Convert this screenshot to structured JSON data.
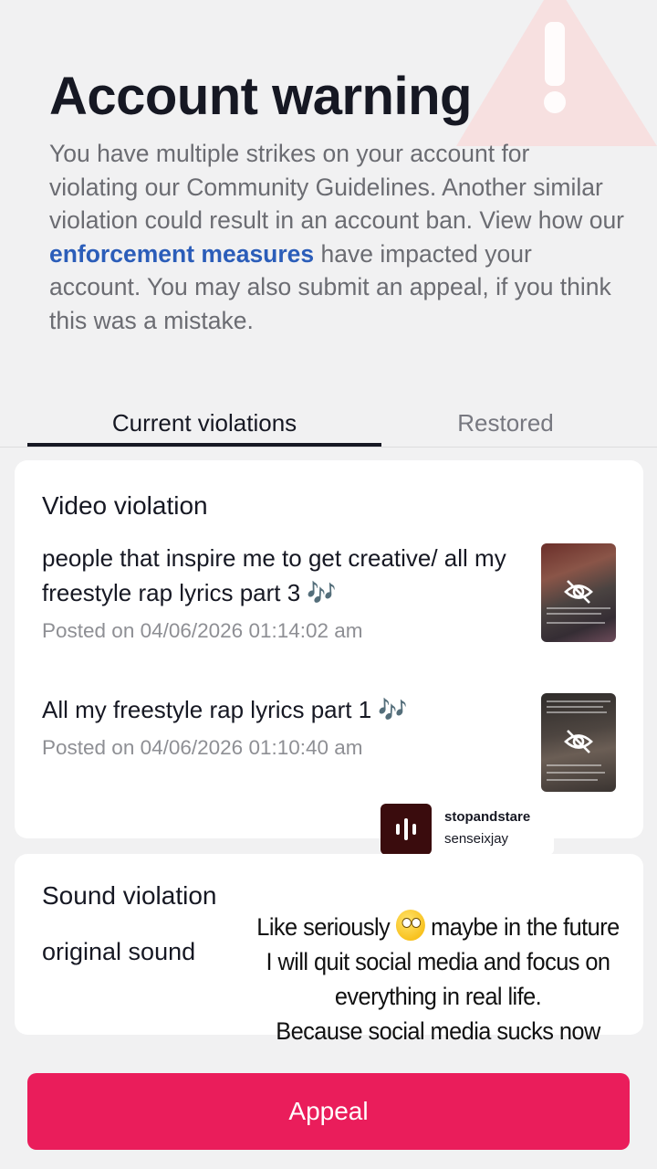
{
  "page": {
    "title": "Account warning",
    "description_before": "You have multiple strikes on your account for violating our Community Guidelines. Another similar violation could result in an account ban. View how our ",
    "description_link": "enforcement measures",
    "description_after": " have impacted your account. You may also submit an appeal, if you think this was a mistake."
  },
  "tabs": [
    {
      "label": "Current violations",
      "active": true
    },
    {
      "label": "Restored",
      "active": false
    }
  ],
  "video_card": {
    "title": "Video violation",
    "items": [
      {
        "title": "people that inspire me to get creative/ all my freestyle rap lyrics part 3 🎶",
        "posted": "Posted on 04/06/2026 01:14:02 am",
        "thumb_icon": "eye-off-icon"
      },
      {
        "title": "All my freestyle rap lyrics part 1 🎶",
        "posted": "Posted on 04/06/2026 01:10:40 am",
        "thumb_icon": "eye-off-icon"
      }
    ]
  },
  "sound_card": {
    "title": "Sound violation",
    "item": "original sound"
  },
  "sticker": {
    "name": "stopandstare",
    "username": "senseixjay"
  },
  "overlay_text": {
    "line1_before": "Like seriously",
    "line1_after": "maybe in the future",
    "line2": "I will quit social media and focus on",
    "line3": "everything in real life.",
    "line4": "Because social media sucks now"
  },
  "appeal_button": {
    "label": "Appeal"
  },
  "colors": {
    "accent": "#ea1d5b",
    "link": "#2b5db9",
    "background": "#f1f1f2"
  }
}
